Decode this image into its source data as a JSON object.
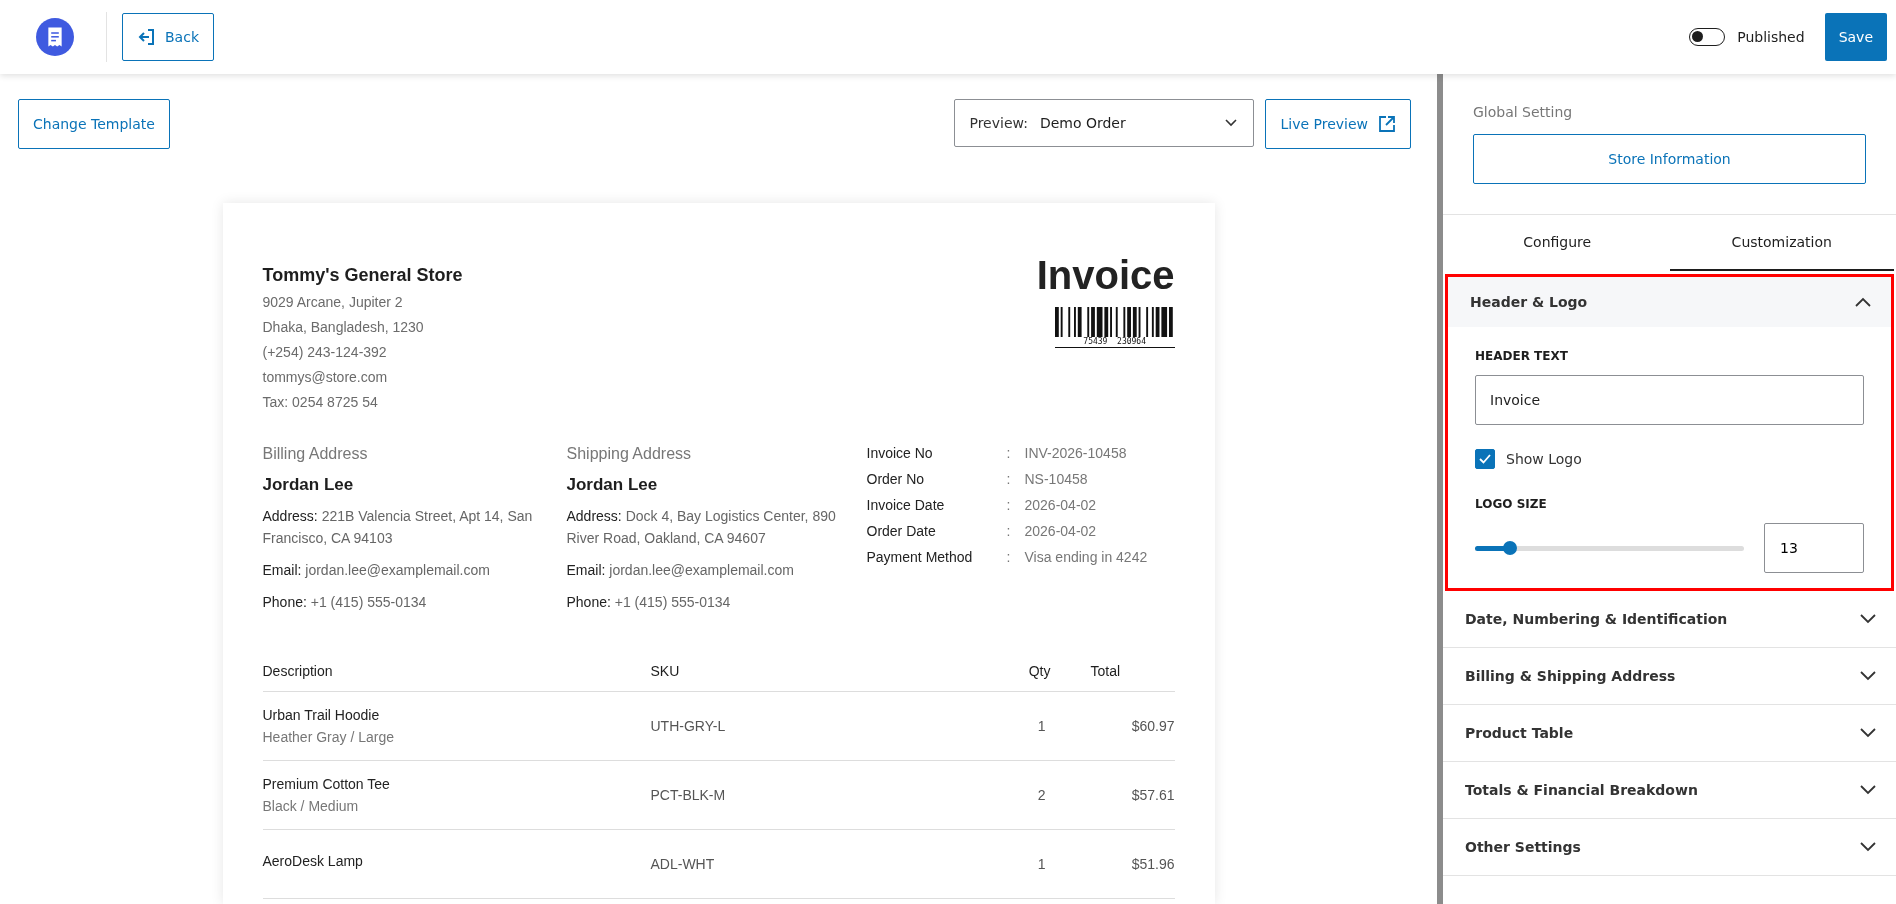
{
  "topbar": {
    "back": "Back",
    "published": {
      "label": "Published",
      "on": false
    },
    "save": "Save"
  },
  "toolbar": {
    "change_template": "Change Template",
    "preview_label": "Preview:",
    "preview_value": "Demo Order",
    "live_preview": "Live Preview"
  },
  "invoice": {
    "store_name": "Tommy's General Store",
    "store_lines": [
      "9029 Arcane, Jupiter 2",
      "Dhaka, Bangladesh, 1230",
      "(+254) 243-124-392",
      "tommys@store.com",
      "Tax: 0254 8725 54"
    ],
    "title": "Invoice",
    "barcode_number": "75439  230964",
    "addresses": [
      {
        "heading": "Billing Address",
        "name": "Jordan Lee",
        "fields": [
          {
            "label": "Address:",
            "value": "221B Valencia Street, Apt 14, San Francisco, CA 94103"
          },
          {
            "label": "Email:",
            "value": "jordan.lee@examplemail.com"
          },
          {
            "label": "Phone:",
            "value": "+1 (415) 555-0134"
          }
        ]
      },
      {
        "heading": "Shipping Address",
        "name": "Jordan Lee",
        "fields": [
          {
            "label": "Address:",
            "value": "Dock 4, Bay Logistics Center, 890 River Road, Oakland, CA 94607"
          },
          {
            "label": "Email:",
            "value": "jordan.lee@examplemail.com"
          },
          {
            "label": "Phone:",
            "value": "+1 (415) 555-0134"
          }
        ]
      }
    ],
    "meta": [
      {
        "label": "Invoice No",
        "sep": ":",
        "value": "INV-2026-10458"
      },
      {
        "label": "Order No",
        "sep": ":",
        "value": "NS-10458"
      },
      {
        "label": "Invoice Date",
        "sep": ":",
        "value": "2026-04-02"
      },
      {
        "label": "Order Date",
        "sep": ":",
        "value": "2026-04-02"
      },
      {
        "label": "Payment Method",
        "sep": ":",
        "value": "Visa ending in 4242"
      }
    ],
    "table": {
      "columns": [
        "Description",
        "SKU",
        "Qty",
        "Total"
      ],
      "rows": [
        {
          "name": "Urban Trail Hoodie",
          "variant": "Heather Gray / Large",
          "sku": "UTH-GRY-L",
          "qty": "1",
          "total": "$60.97"
        },
        {
          "name": "Premium Cotton Tee",
          "variant": "Black / Medium",
          "sku": "PCT-BLK-M",
          "qty": "2",
          "total": "$57.61"
        },
        {
          "name": "AeroDesk Lamp",
          "sku": "ADL-WHT",
          "qty": "1",
          "total": "$51.96"
        }
      ]
    }
  },
  "sidebar": {
    "global_heading": "Global Setting",
    "store_button": "Store Information",
    "tabs": [
      {
        "label": "Configure",
        "selected": false
      },
      {
        "label": "Customization",
        "selected": true
      }
    ],
    "sections": [
      {
        "title": "Header & Logo",
        "expanded": true,
        "highlighted": true,
        "header_text": {
          "label": "HEADER TEXT",
          "value": "Invoice"
        },
        "show_logo": {
          "label": "Show Logo",
          "checked": true
        },
        "logo_size": {
          "label": "LOGO SIZE",
          "level": 0.13,
          "value": "13"
        }
      },
      {
        "title": "Date, Numbering & Identification",
        "expanded": false,
        "highlighted": false
      },
      {
        "title": "Billing & Shipping Address",
        "expanded": false,
        "highlighted": false
      },
      {
        "title": "Product Table",
        "expanded": false,
        "highlighted": false
      },
      {
        "title": "Totals & Financial Breakdown",
        "expanded": false,
        "highlighted": false
      },
      {
        "title": "Other Settings",
        "expanded": false,
        "highlighted": false
      }
    ]
  }
}
